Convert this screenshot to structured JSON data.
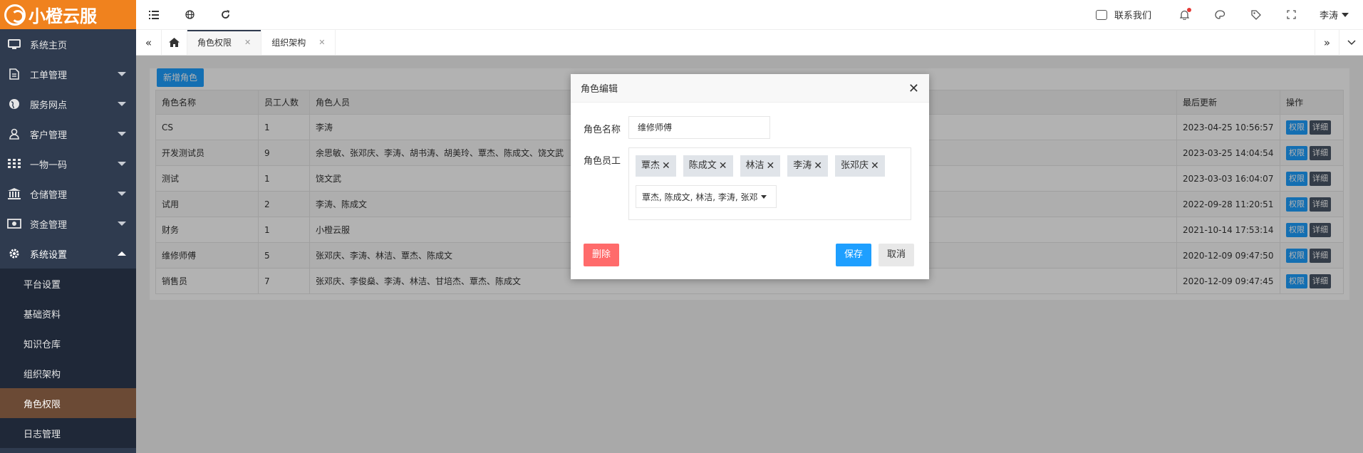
{
  "brand": {
    "name": "小橙云服"
  },
  "sidebar": {
    "items": [
      {
        "label": "系统主页",
        "icon": "monitor-icon"
      },
      {
        "label": "工单管理",
        "icon": "document-icon"
      },
      {
        "label": "服务网点",
        "icon": "globe-icon"
      },
      {
        "label": "客户管理",
        "icon": "user-icon"
      },
      {
        "label": "一物一码",
        "icon": "grid-icon"
      },
      {
        "label": "仓储管理",
        "icon": "bank-icon"
      },
      {
        "label": "资金管理",
        "icon": "money-icon"
      },
      {
        "label": "系统设置",
        "icon": "gear-icon"
      }
    ],
    "subitems": [
      {
        "label": "平台设置"
      },
      {
        "label": "基础资料"
      },
      {
        "label": "知识仓库"
      },
      {
        "label": "组织架构"
      },
      {
        "label": "角色权限"
      },
      {
        "label": "日志管理"
      }
    ]
  },
  "topbar": {
    "contact_label": "联系我们",
    "user_name": "李涛"
  },
  "tabs": [
    {
      "label": "角色权限"
    },
    {
      "label": "组织架构"
    }
  ],
  "page": {
    "add_button": "新增角色",
    "columns": [
      "角色名称",
      "员工人数",
      "角色人员",
      "最后更新",
      "操作"
    ],
    "rows": [
      {
        "name": "CS",
        "count": "1",
        "members": "李涛",
        "updated": "2023-04-25 10:56:57"
      },
      {
        "name": "开发测试员",
        "count": "9",
        "members": "余思敏、张邓庆、李涛、胡书涛、胡美玲、覃杰、陈成文、饶文武",
        "updated": "2023-03-25 14:04:54"
      },
      {
        "name": "测试",
        "count": "1",
        "members": "饶文武",
        "updated": "2023-03-03 16:04:07"
      },
      {
        "name": "试用",
        "count": "2",
        "members": "李涛、陈成文",
        "updated": "2022-09-28 11:20:51"
      },
      {
        "name": "财务",
        "count": "1",
        "members": "小橙云服",
        "updated": "2021-10-14 17:53:14"
      },
      {
        "name": "维修师傅",
        "count": "5",
        "members": "张邓庆、李涛、林洁、覃杰、陈成文",
        "updated": "2020-12-09 09:47:50"
      },
      {
        "name": "销售员",
        "count": "7",
        "members": "张邓庆、李俊燊、李涛、林洁、甘培杰、覃杰、陈成文",
        "updated": "2020-12-09 09:47:45"
      }
    ],
    "action_perm": "权限",
    "action_detail": "详细"
  },
  "modal": {
    "title": "角色编辑",
    "name_label": "角色名称",
    "name_value": "维修师傅",
    "staff_label": "角色员工",
    "tags": [
      "覃杰",
      "陈成文",
      "林洁",
      "李涛",
      "张邓庆"
    ],
    "select_text": "覃杰, 陈成文, 林洁, 李涛, 张邓",
    "delete_label": "删除",
    "save_label": "保存",
    "cancel_label": "取消"
  },
  "colors": {
    "brand": "#f0821e",
    "sidebar": "#2f3b4f",
    "primary": "#1e9fff",
    "danger": "#ff6b6b",
    "active_sub": "#6b4a35"
  }
}
